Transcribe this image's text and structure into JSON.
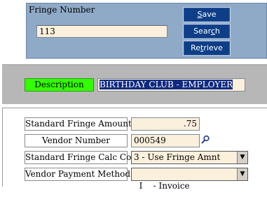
{
  "top": {
    "fringe_label": "Fringe Number",
    "fringe_value": "113",
    "buttons": {
      "save_pre": "",
      "save_u": "S",
      "save_post": "ave",
      "search_pre": "Sear",
      "search_u": "c",
      "search_post": "h",
      "retrieve_pre": "Re",
      "retrieve_u": "t",
      "retrieve_post": "rieve"
    }
  },
  "description": {
    "label": "Description",
    "value": "BIRTHDAY CLUB - EMPLOYER"
  },
  "details": {
    "standard_fringe_amount_label": "Standard Fringe Amount",
    "standard_fringe_amount_value": ".75",
    "vendor_number_label": "Vendor Number",
    "vendor_number_value": "000549",
    "calc_code_label": "Standard Fringe Calc Code",
    "calc_code_value": "3 - Use Fringe Amnt",
    "payment_method_label": "Vendor Payment Method",
    "payment_method_value": "I    - Invoice"
  },
  "icons": {
    "lookup": "magnifier-icon",
    "dropdown": "chevron-down-icon"
  },
  "colors": {
    "top_panel": "#8faac7",
    "button_bg": "#0e3f86",
    "description_button": "#33ff00",
    "field_bg": "#fbf0dc",
    "selection": "#102a80"
  }
}
